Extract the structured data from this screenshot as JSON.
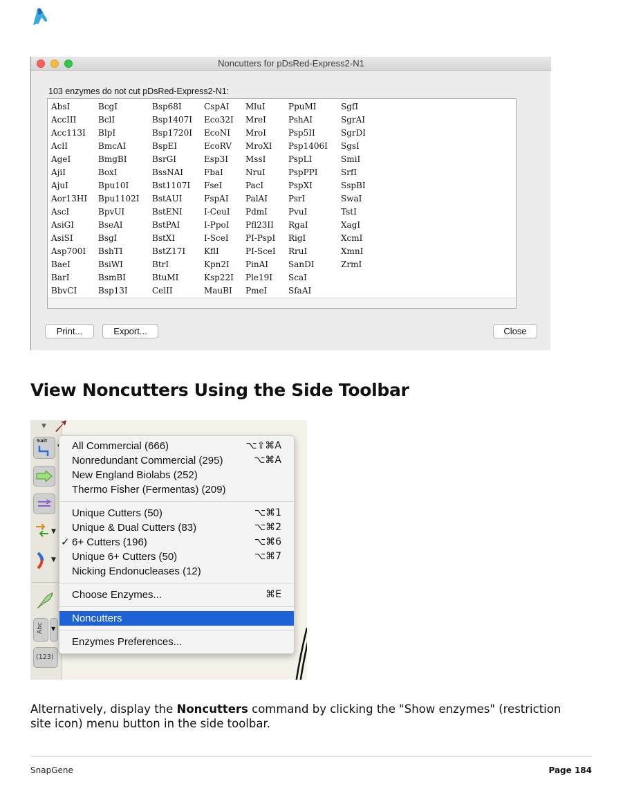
{
  "dialog": {
    "title": "Noncutters for pDsRed-Express2-N1",
    "count_text": "103 enzymes do not cut pDsRed-Express2-N1:",
    "columns": [
      [
        "AbsI",
        "AccIII",
        "Acc113I",
        "AclI",
        "AgeI",
        "AjiI",
        "AjuI",
        "Aor13HI",
        "AscI",
        "AsiGI",
        "AsiSI",
        "Asp700I",
        "BaeI",
        "BarI",
        "BbvCI"
      ],
      [
        "BcgI",
        "BclI",
        "BlpI",
        "BmcAI",
        "BmgBI",
        "BoxI",
        "Bpu10I",
        "Bpu1102I",
        "BpvUI",
        "BseAI",
        "BsgI",
        "BshTI",
        "BsiWI",
        "BsmBI",
        "Bsp13I"
      ],
      [
        "Bsp68I",
        "Bsp1407I",
        "Bsp1720I",
        "BspEI",
        "BsrGI",
        "BssNAI",
        "Bst1107I",
        "BstAUI",
        "BstENI",
        "BstPAI",
        "BstXI",
        "BstZ17I",
        "BtrI",
        "BtuMI",
        "CelII"
      ],
      [
        "CspAI",
        "Eco32I",
        "EcoNI",
        "EcoRV",
        "Esp3I",
        "FbaI",
        "FseI",
        "FspAI",
        "I-CeuI",
        "I-PpoI",
        "I-SceI",
        "KflI",
        "Kpn2I",
        "Ksp22I",
        "MauBI"
      ],
      [
        "MluI",
        "MreI",
        "MroI",
        "MroXI",
        "MssI",
        "NruI",
        "PacI",
        "PalAI",
        "PdmI",
        "Pfl23II",
        "PI-PspI",
        "PI-SceI",
        "PinAI",
        "Ple19I",
        "PmeI"
      ],
      [
        "PpuMI",
        "PshAI",
        "Psp5II",
        "Psp1406I",
        "PspLI",
        "PspPPI",
        "PspXI",
        "PsrI",
        "PvuI",
        "RgaI",
        "RigI",
        "RruI",
        "SanDI",
        "ScaI",
        "SfaAI"
      ],
      [
        "SgfI",
        "SgrAI",
        "SgrDI",
        "SgsI",
        "SmiI",
        "SrfI",
        "SspBI",
        "SwaI",
        "TstI",
        "XagI",
        "XcmI",
        "XmnI",
        "ZrmI"
      ]
    ],
    "buttons": {
      "print": "Print...",
      "export": "Export...",
      "close": "Close"
    }
  },
  "heading": "View Noncutters Using the Side Toolbar",
  "menu": {
    "toolbar_labels": {
      "salt": "Salt",
      "abc": "Abc",
      "num": "(123)"
    },
    "groups": [
      [
        {
          "label": "All Commercial  (666)",
          "shortcut": "⌥⇧⌘A"
        },
        {
          "label": "Nonredundant Commercial  (295)",
          "shortcut": "⌥⌘A"
        },
        {
          "label": "New England Biolabs  (252)",
          "shortcut": ""
        },
        {
          "label": "Thermo Fisher (Fermentas)  (209)",
          "shortcut": ""
        }
      ],
      [
        {
          "label": "Unique Cutters  (50)",
          "shortcut": "⌥⌘1"
        },
        {
          "label": "Unique & Dual Cutters  (83)",
          "shortcut": "⌥⌘2"
        },
        {
          "label": "6+ Cutters  (196)",
          "shortcut": "⌥⌘6",
          "checked": "✓"
        },
        {
          "label": "Unique 6+ Cutters  (50)",
          "shortcut": "⌥⌘7"
        },
        {
          "label": "Nicking Endonucleases  (12)",
          "shortcut": ""
        }
      ],
      [
        {
          "label": "Choose Enzymes...",
          "shortcut": "⌘E"
        }
      ],
      [
        {
          "label": "Noncutters",
          "shortcut": "",
          "selected": true
        }
      ],
      [
        {
          "label": "Enzymes Preferences...",
          "shortcut": ""
        }
      ]
    ]
  },
  "paragraph": {
    "before": "Alternatively, display the ",
    "bold": "Noncutters",
    "after": " command by clicking the \"Show enzymes\" (restriction site icon) menu button in the side toolbar."
  },
  "footer": {
    "left": "SnapGene",
    "right": "Page 184"
  }
}
